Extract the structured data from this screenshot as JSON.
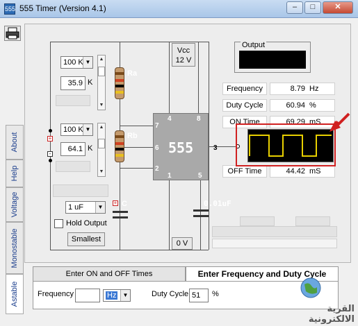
{
  "window": {
    "title": "555 Timer  (Version 4.1)",
    "icon_label": "555",
    "min_label": "–",
    "max_label": "□",
    "close_label": "✕"
  },
  "vertical_tabs": [
    "About",
    "Help",
    "Voltage",
    "Monostable",
    "Astable"
  ],
  "circuit": {
    "ra_combo": "100 K",
    "ra_value": "35.9",
    "ra_unit": "K",
    "ra_label": "Ra",
    "rb_combo": "100 K",
    "rb_value": "64.1",
    "rb_unit": "K",
    "rb_label": "Rb",
    "cap_combo": "1 uF",
    "cap_label": "C",
    "hold_output": "Hold Output",
    "hold_checked": false,
    "smallest_button": "Smallest",
    "vcc_label": "Vcc",
    "vcc_value": "12 V",
    "ground_label": "0 V",
    "cap2_label": "0.01uF",
    "chip_label": "555",
    "pins": {
      "p4": "4",
      "p8": "8",
      "p7": "7",
      "p6": "6",
      "p2": "2",
      "p3": "3",
      "p1": "1",
      "p5": "5"
    }
  },
  "output": {
    "legend": "Output"
  },
  "readouts": {
    "frequency_label": "Frequency",
    "frequency_value": "8.79",
    "frequency_unit": "Hz",
    "duty_label": "Duty Cycle",
    "duty_value": "60.94",
    "duty_unit": "%",
    "on_label": "ON Time",
    "on_value": "69.29",
    "on_unit": "mS",
    "off_label": "OFF Time",
    "off_value": "44.42",
    "off_unit": "mS"
  },
  "bottom_tabs": {
    "tab1": "Enter ON and OFF Times",
    "tab2": "Enter Frequency and Duty Cycle",
    "frequency_label": "Frequency",
    "frequency_value": "",
    "frequency_unit": "Hz",
    "duty_label": "Duty Cycle",
    "duty_value": "51",
    "duty_unit": "%"
  },
  "watermark": "القرية الالكترونية",
  "colors": {
    "highlight_red": "#d02020",
    "tab_text": "#1a3d8c"
  }
}
